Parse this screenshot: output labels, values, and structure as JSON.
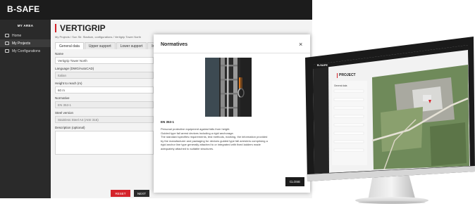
{
  "app": {
    "brand": "B-SAFE",
    "sidebar": {
      "heading": "MY AREA",
      "items": [
        {
          "label": "Home"
        },
        {
          "label": "My Projects"
        },
        {
          "label": "My Configurations"
        }
      ]
    },
    "page_title": "VERTIGRIP",
    "breadcrumb": "My Projects / Sun Str. Stadium, configurations / Vertigrip Tower North",
    "tabs": [
      "General data",
      "Upper support",
      "Lower support",
      "In"
    ],
    "form": {
      "name_label": "Name",
      "name_value": "Vertigrip Tower North",
      "language_label": "Language (DWG/AutoCAD)",
      "language_value": "Italian",
      "height_label": "Height to reach (m)",
      "height_value": "60 m",
      "normative_label": "Normative",
      "normative_value": "EN 353-1",
      "steel_label": "Steel version",
      "steel_value": "Stainless Steel A4 (AISI 316)",
      "description_label": "Description (optional)"
    },
    "reset_label": "RESET",
    "next_label": "NEXT"
  },
  "modal": {
    "title": "Normatives",
    "close_icon": "×",
    "standard": "EN 353-1",
    "description": [
      "Personal protective equipment against falls from height.",
      "Guided type fall arrest devices including a rigid anchorage.",
      "The standard specifies requirements, test methods, marking, the information provided",
      "by the manufacturer and packaging for devices guided type fall arresters comprising a",
      "rigid anchor line type generally attached to or integrated with fixed ladders made",
      "adequately attached to suitable structures."
    ],
    "close_button": "CLOSE"
  },
  "monitor": {
    "brand": "B-SAFE",
    "title": "PROJECT",
    "subtitle": "General data"
  },
  "colors": {
    "accent": "#d4232a",
    "topbar": "#1c1c1c",
    "sidebar": "#2a2a2a"
  }
}
